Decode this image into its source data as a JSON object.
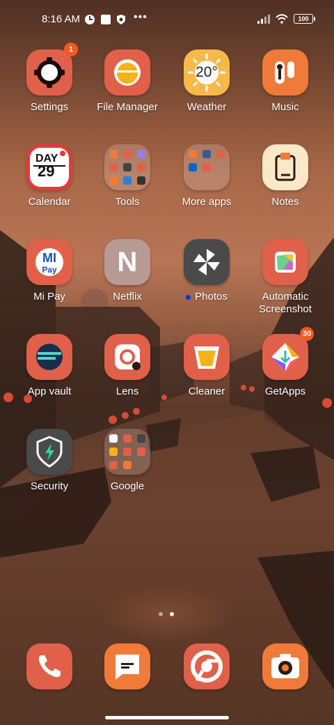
{
  "status": {
    "time": "8:16 AM",
    "battery": "100"
  },
  "apps": {
    "settings": {
      "label": "Settings",
      "badge": "1"
    },
    "file_manager": {
      "label": "File Manager"
    },
    "weather": {
      "label": "Weather",
      "temp": "20°"
    },
    "music": {
      "label": "Music"
    },
    "calendar": {
      "label": "Calendar",
      "day_word": "DAY",
      "day_num": "29"
    },
    "tools": {
      "label": "Tools"
    },
    "more_apps": {
      "label": "More apps"
    },
    "notes": {
      "label": "Notes"
    },
    "mipay": {
      "label": "Mi Pay",
      "logo_top": "MI",
      "logo_bottom": "Pay"
    },
    "netflix": {
      "label": "Netflix",
      "letter": "N"
    },
    "photos": {
      "label": "Photos"
    },
    "auto_screenshot": {
      "label": "Automatic Screenshot"
    },
    "app_vault": {
      "label": "App vault"
    },
    "lens": {
      "label": "Lens"
    },
    "cleaner": {
      "label": "Cleaner"
    },
    "getapps": {
      "label": "GetApps",
      "badge": "30"
    },
    "security": {
      "label": "Security"
    },
    "google": {
      "label": "Google"
    }
  },
  "colors": {
    "accent": "#e0604a",
    "orange": "#f07a3a",
    "badge": "#f05a22",
    "photos_dot": "#1030e0"
  },
  "dock": [
    "phone-icon",
    "messages-icon",
    "chrome-icon",
    "camera-icon"
  ],
  "pages": {
    "count": 2,
    "active": 2
  }
}
